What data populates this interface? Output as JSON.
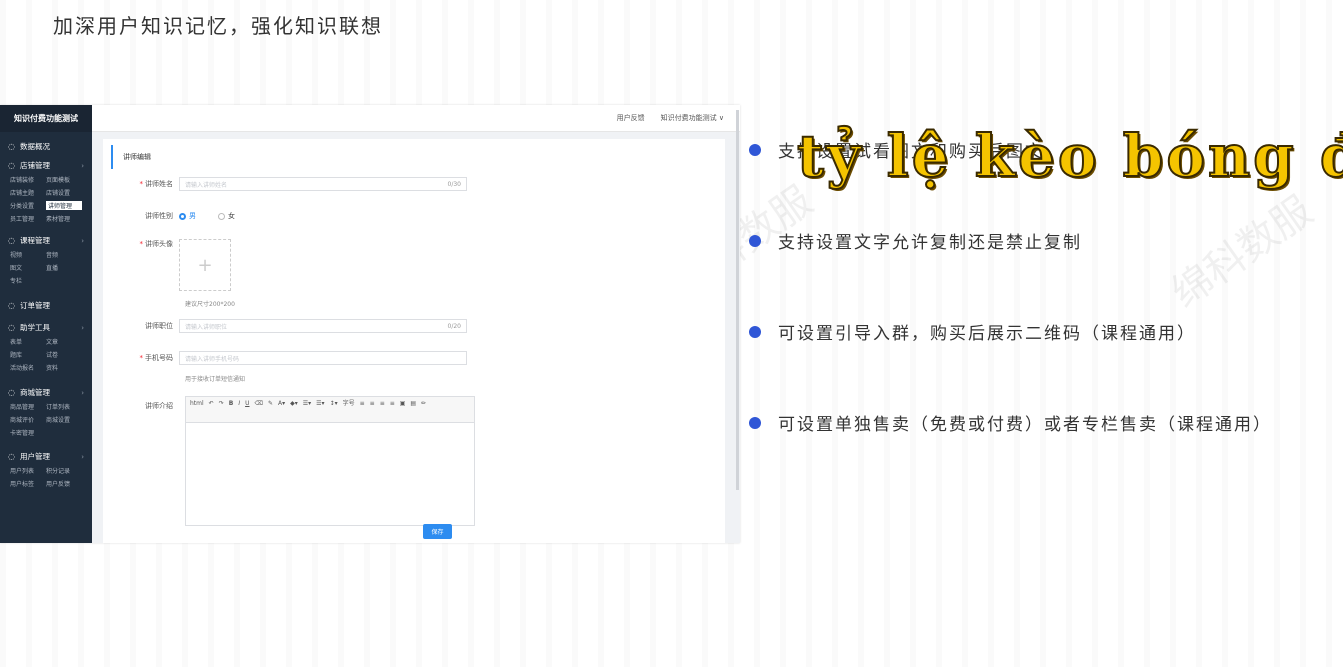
{
  "heading": "加深用户知识记忆，强化知识联想",
  "watermark": "绵科数服",
  "admin": {
    "app_title": "知识付费功能测试",
    "topbar": {
      "feedback": "用户反馈",
      "account": "知识付费功能测试 ∨"
    },
    "sidebar": {
      "groups": [
        {
          "label": "数据概况",
          "icon": "clock-icon",
          "items": []
        },
        {
          "label": "店铺管理",
          "icon": "store-icon",
          "items": [
            "店铺装修",
            "页面模板",
            "店铺主题",
            "店铺设置",
            "分类设置",
            "讲师管理",
            "员工管理",
            "素材管理"
          ]
        },
        {
          "label": "课程管理",
          "icon": "book-icon",
          "items": [
            "视频",
            "音频",
            "图文",
            "直播",
            "专栏"
          ]
        },
        {
          "label": "订单管理",
          "icon": "order-icon",
          "items": []
        },
        {
          "label": "助学工具",
          "icon": "tool-icon",
          "items": [
            "表单",
            "文章",
            "题库",
            "试卷",
            "活动报名",
            "资料"
          ]
        },
        {
          "label": "商城管理",
          "icon": "shop-icon",
          "items": [
            "商品管理",
            "订单列表",
            "商城评价",
            "商城设置",
            "卡密管理"
          ]
        },
        {
          "label": "用户管理",
          "icon": "user-icon",
          "items": [
            "用户列表",
            "积分记录",
            "用户标签",
            "用户反馈"
          ]
        }
      ],
      "active_item": "讲师管理"
    },
    "form": {
      "section_title": "讲师编辑",
      "name_label": "讲师姓名",
      "name_placeholder": "请输入讲师姓名",
      "name_count": "0/30",
      "gender_label": "讲师性别",
      "gender_male": "男",
      "gender_female": "女",
      "avatar_label": "讲师头像",
      "avatar_hint": "建议尺寸200*200",
      "title_label": "讲师职位",
      "title_placeholder": "请输入讲师职位",
      "title_count": "0/20",
      "phone_label": "手机号码",
      "phone_placeholder": "请输入讲师手机号码",
      "phone_hint": "用于接收订单短信通知",
      "intro_label": "讲师介绍",
      "font_select": "字号",
      "save_label": "保存"
    }
  },
  "features": [
    "支持设置试看图文和购买后图文",
    "支持设置文字允许复制还是禁止复制",
    "可设置引导入群，购买后展示二维码（课程通用）",
    "可设置单独售卖（免费或付费）或者专栏售卖（课程通用）"
  ],
  "overlay_text": "tỷ lệ kèo bóng đá",
  "colors": {
    "bullet": "#2f56d6",
    "sidebar": "#1f2d3d",
    "primary": "#2d8cf0",
    "overlay": "#f5c400"
  }
}
